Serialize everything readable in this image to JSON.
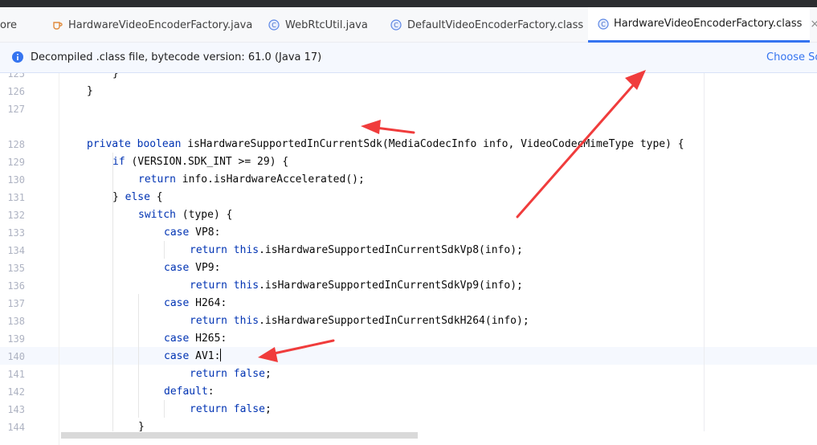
{
  "tabs": [
    {
      "label": "ore",
      "icon": "none"
    },
    {
      "label": "HardwareVideoEncoderFactory.java",
      "icon": "java-file-icon"
    },
    {
      "label": "WebRtcUtil.java",
      "icon": "class-icon"
    },
    {
      "label": "DefaultVideoEncoderFactory.class",
      "icon": "class-icon"
    },
    {
      "label": "HardwareVideoEncoderFactory.class",
      "icon": "class-icon",
      "active": true
    }
  ],
  "tab_close_glyph": "×",
  "infobar": {
    "message": "Decompiled .class file, bytecode version: 61.0 (Java 17)",
    "action": "Choose So"
  },
  "lines": [
    {
      "n": "125",
      "indent": 2,
      "text": "}"
    },
    {
      "n": "126",
      "indent": 1,
      "text": "}"
    },
    {
      "n": "127",
      "indent": 0,
      "text": ""
    },
    {
      "n": "128",
      "indent": 1,
      "text": "private boolean isHardwareSupportedInCurrentSdk(MediaCodecInfo info, VideoCodecMimeType type) {"
    },
    {
      "n": "129",
      "indent": 2,
      "text": "if (VERSION.SDK_INT >= 29) {"
    },
    {
      "n": "130",
      "indent": 3,
      "text": "return info.isHardwareAccelerated();"
    },
    {
      "n": "131",
      "indent": 2,
      "text": "} else {"
    },
    {
      "n": "132",
      "indent": 3,
      "text": "switch (type) {"
    },
    {
      "n": "133",
      "indent": 4,
      "text": "case VP8:"
    },
    {
      "n": "134",
      "indent": 5,
      "text": "return this.isHardwareSupportedInCurrentSdkVp8(info);"
    },
    {
      "n": "135",
      "indent": 4,
      "text": "case VP9:"
    },
    {
      "n": "136",
      "indent": 5,
      "text": "return this.isHardwareSupportedInCurrentSdkVp9(info);"
    },
    {
      "n": "137",
      "indent": 4,
      "text": "case H264:"
    },
    {
      "n": "138",
      "indent": 5,
      "text": "return this.isHardwareSupportedInCurrentSdkH264(info);"
    },
    {
      "n": "139",
      "indent": 4,
      "text": "case H265:"
    },
    {
      "n": "140",
      "indent": 4,
      "text": "case AV1:"
    },
    {
      "n": "141",
      "indent": 5,
      "text": "return false;"
    },
    {
      "n": "142",
      "indent": 4,
      "text": "default:"
    },
    {
      "n": "143",
      "indent": 5,
      "text": "return false;"
    },
    {
      "n": "144",
      "indent": 3,
      "text": "}"
    }
  ],
  "keywords": [
    "private",
    "boolean",
    "if",
    "return",
    "else",
    "switch",
    "case",
    "this",
    "false",
    "default"
  ],
  "caret_line": "140",
  "colors": {
    "accent": "#3574f0",
    "keyword": "#0033b3",
    "annotation_arrow": "#f03c3c"
  }
}
